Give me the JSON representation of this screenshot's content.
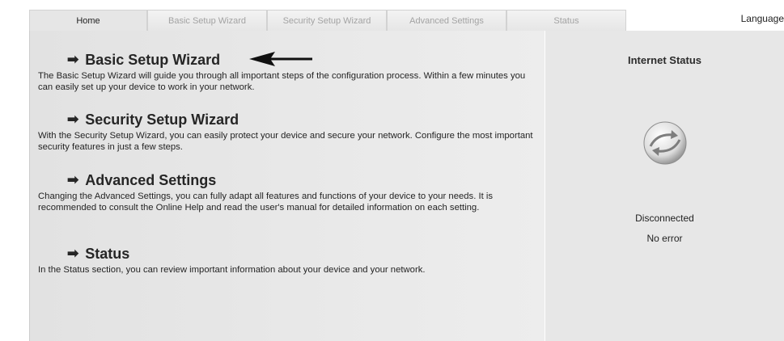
{
  "tabs": [
    {
      "label": "Home",
      "active": true
    },
    {
      "label": "Basic Setup Wizard",
      "active": false
    },
    {
      "label": "Security Setup Wizard",
      "active": false
    },
    {
      "label": "Advanced Settings",
      "active": false
    },
    {
      "label": "Status",
      "active": false
    }
  ],
  "language_label": "Language",
  "sections": [
    {
      "arrow": "➡",
      "title": "Basic Setup Wizard",
      "description": "The Basic Setup Wizard will guide you through all important steps of the configuration process. Within a few minutes you can easily set up your device to work in your network."
    },
    {
      "arrow": "➡",
      "title": "Security Setup Wizard",
      "description": "With the Security Setup Wizard, you can easily protect your device and secure your network. Configure the most important security features in just a few steps."
    },
    {
      "arrow": "➡",
      "title": "Advanced Settings",
      "description": "Changing the Advanced Settings, you can fully adapt all features and functions of your device to your needs. It is recommended to consult the Online Help and read the user's manual for detailed information on each setting."
    },
    {
      "arrow": "➡",
      "title": "Status",
      "description": "In the Status section, you can review important information about your device and your network."
    }
  ],
  "internet_status": {
    "title": "Internet Status",
    "icon": "globe-connection-icon",
    "connection": "Disconnected",
    "error": "No error"
  },
  "colors": {
    "panel_bg": "#e4e4e4",
    "tab_inactive_text": "#a3a3a3",
    "text": "#1e1e1e"
  }
}
